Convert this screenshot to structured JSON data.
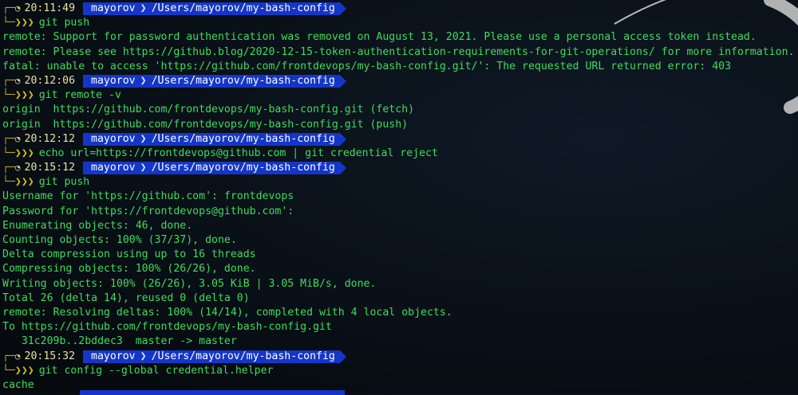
{
  "prompt": {
    "user": "mayorov",
    "separator": "❯",
    "path": "/Users/mayorov/my-bash-config",
    "arrows": "❯❯❯"
  },
  "entries": [
    {
      "time": "20:11:49",
      "command": "git push",
      "output": [
        "remote: Support for password authentication was removed on August 13, 2021. Please use a personal access token instead.",
        "remote: Please see https://github.blog/2020-12-15-token-authentication-requirements-for-git-operations/ for more information.",
        "fatal: unable to access 'https://github.com/frontdevops/my-bash-config.git/': The requested URL returned error: 403"
      ]
    },
    {
      "time": "20:12:06",
      "command": "git remote -v",
      "output": [
        "origin  https://github.com/frontdevops/my-bash-config.git (fetch)",
        "origin  https://github.com/frontdevops/my-bash-config.git (push)"
      ]
    },
    {
      "time": "20:12:12",
      "command": "echo url=https://frontdevops@github.com | git credential reject",
      "output": []
    },
    {
      "time": "20:15:12",
      "command": "git push",
      "output": [
        "Username for 'https://github.com': frontdevops",
        "Password for 'https://frontdevops@github.com':",
        "Enumerating objects: 46, done.",
        "Counting objects: 100% (37/37), done.",
        "Delta compression using up to 16 threads",
        "Compressing objects: 100% (26/26), done.",
        "Writing objects: 100% (26/26), 3.05 KiB | 3.05 MiB/s, done.",
        "Total 26 (delta 14), reused 0 (delta 0)",
        "remote: Resolving deltas: 100% (14/14), completed with 4 local objects.",
        "To https://github.com/frontdevops/my-bash-config.git",
        "   31c209b..2bddec3  master -> master"
      ]
    },
    {
      "time": "20:15:32",
      "command": "git config --global credential.helper",
      "output": [
        "cache"
      ]
    }
  ],
  "colors": {
    "output_green": "#3fdc5c",
    "prompt_blue": "#1436c8",
    "arrow_yellow": "#d4c021"
  },
  "icons": {
    "clock": "clock-icon",
    "corner_top": "box-corner-top",
    "corner_bottom": "box-corner-bottom"
  }
}
